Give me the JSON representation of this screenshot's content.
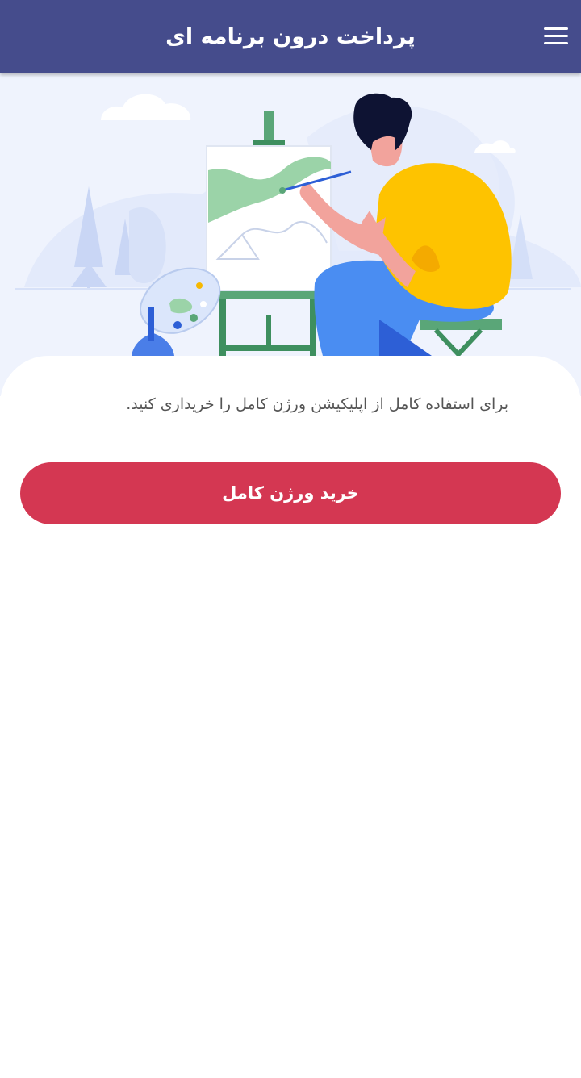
{
  "header": {
    "title": "پرداخت درون برنامه ای",
    "menu_icon": "hamburger-menu-icon"
  },
  "hero": {
    "illustration": "artist-painting-illustration"
  },
  "content": {
    "message": "برای استفاده کامل از اپلیکیشن ورژن کامل را خریداری کنید.",
    "buy_button_label": "خرید ورژن کامل"
  },
  "colors": {
    "header_bg": "#454c8c",
    "button_bg": "#d43752",
    "hero_bg": "#eff3fd"
  }
}
